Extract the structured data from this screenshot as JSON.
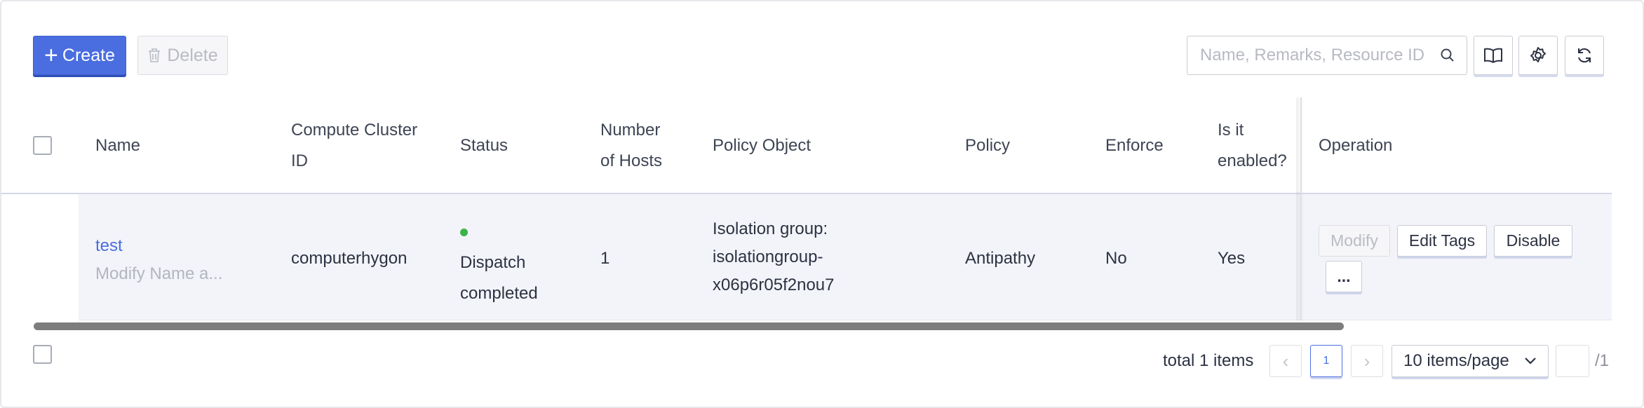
{
  "toolbar": {
    "create_label": "Create",
    "delete_label": "Delete",
    "search_placeholder": "Name, Remarks, Resource ID"
  },
  "table": {
    "headers": {
      "name": "Name",
      "compute_cluster_id_1": "Compute Cluster",
      "compute_cluster_id_2": "ID",
      "status": "Status",
      "hosts_1": "Number",
      "hosts_2": "of Hosts",
      "policy_object": "Policy Object",
      "policy": "Policy",
      "enforce": "Enforce",
      "enabled_1": "Is it",
      "enabled_2": "enabled?",
      "operation": "Operation"
    },
    "rows": [
      {
        "name": "test",
        "remark": "Modify Name a...",
        "cluster_id": "computerhygon",
        "status_1": "Dispatch",
        "status_2": "completed",
        "status_color": "#3bb34a",
        "hosts": "1",
        "policy_object_1": "Isolation group:",
        "policy_object_2": "isolationgroup-",
        "policy_object_3": "x06p6r05f2nou7",
        "policy": "Antipathy",
        "enforce": "No",
        "enabled": "Yes",
        "ops": {
          "modify": "Modify",
          "edit_tags": "Edit Tags",
          "disable": "Disable",
          "more": "..."
        }
      }
    ]
  },
  "pagination": {
    "total": "total 1 items",
    "current_page": "1",
    "page_size": "10 items/page",
    "total_pages": "/1"
  },
  "colors": {
    "accent": "#4a6ee0",
    "status_success": "#3bb34a"
  }
}
